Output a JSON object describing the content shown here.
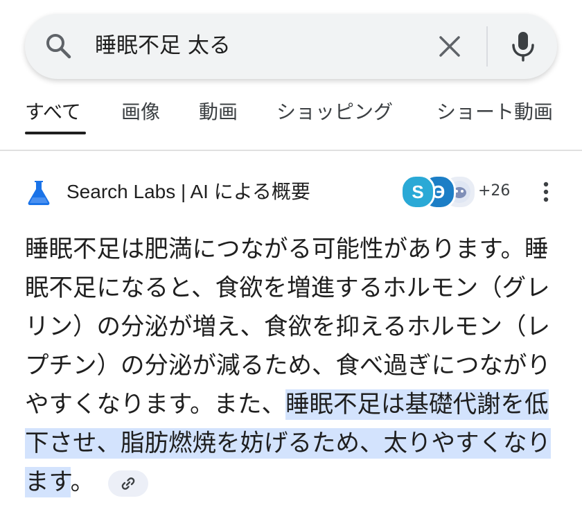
{
  "search": {
    "query": "睡眠不足 太る"
  },
  "tabs": [
    {
      "label": "すべて",
      "active": true
    },
    {
      "label": "画像",
      "active": false
    },
    {
      "label": "動画",
      "active": false
    },
    {
      "label": "ショッピング",
      "active": false
    },
    {
      "label": "ショート動画",
      "active": false
    }
  ],
  "ai_overview": {
    "title": "Search Labs | AI による概要",
    "source_badges": [
      "S",
      "Э",
      ""
    ],
    "source_count": "+26",
    "summary_plain": "睡眠不足は肥満につながる可能性があります。睡眠不足になると、食欲を増進するホルモン（グレリン）の分泌が増え、食欲を抑えるホルモン（レプチン）の分泌が減るため、食べ過ぎにつながりやすくなります。また、",
    "summary_highlight": "睡眠不足は基礎代謝を低下させ、脂肪燃焼を妨げるため、太りやすくなります",
    "summary_end": "。"
  },
  "colors": {
    "accent_blue": "#1a73e8",
    "highlight": "#d3e3fd",
    "text": "#1f1f1f"
  },
  "icons": [
    "search-icon",
    "clear-icon",
    "mic-icon",
    "labs-flask-icon",
    "more-vert-icon",
    "link-icon"
  ]
}
